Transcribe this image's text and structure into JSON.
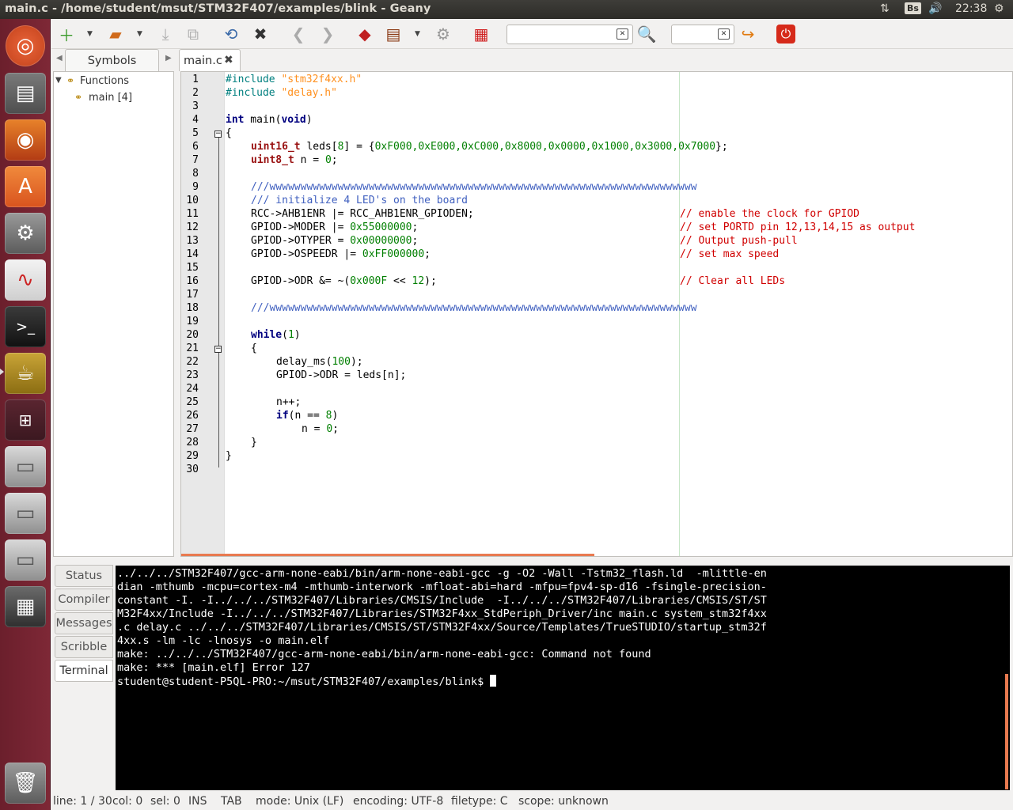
{
  "window_title": "main.c - /home/student/msut/STM32F407/examples/blink - Geany",
  "indicators": {
    "keyboard": "Bs",
    "time": "22:38"
  },
  "sidebar": {
    "tab_label": "Symbols",
    "functions_label": "Functions",
    "main_item": "main [4]"
  },
  "editor": {
    "tab_label": "main.c",
    "lines": [
      "1",
      "2",
      "3",
      "4",
      "5",
      "6",
      "7",
      "8",
      "9",
      "10",
      "11",
      "12",
      "13",
      "14",
      "15",
      "16",
      "17",
      "18",
      "19",
      "20",
      "21",
      "22",
      "23",
      "24",
      "25",
      "26",
      "27",
      "28",
      "29",
      "30"
    ],
    "code": {
      "l1_kw": "#include ",
      "l1_str": "\"stm32f4xx.h\"",
      "l2_kw": "#include ",
      "l2_str": "\"delay.h\"",
      "l4_kw1": "int",
      "l4_mid": " main(",
      "l4_kw2": "void",
      "l4_end": ")",
      "l5": "{",
      "l6_ty": "uint16_t",
      "l6_a": " leds[",
      "l6_n": "8",
      "l6_b": "] = {",
      "l6_vals": "0xF000,0xE000,0xC000,0x8000,0x0000,0x1000,0x3000,0x7000",
      "l6_c": "};",
      "l7_ty": "uint8_t",
      "l7_a": " n = ",
      "l7_n": "0",
      "l7_c": ";",
      "l9": "///wwwwwwwwwwwwwwwwwwwwwwwwwwwwwwwwwwwwwwwwwwwwwwwwwwwwwwwwwwwwwwwwwwwww",
      "l10": "/// initialize 4 LED's on the board",
      "l11_code": "RCC->AHB1ENR |= RCC_AHB1ENR_GPIODEN;",
      "l11_cm": "// enable the clock for GPIOD",
      "l12_a": "GPIOD->MODER |= ",
      "l12_n": "0x55000000",
      "l12_c": ";",
      "l12_cm": "// set PORTD pin 12,13,14,15 as output",
      "l13_a": "GPIOD->OTYPER = ",
      "l13_n": "0x00000000",
      "l13_c": ";",
      "l13_cm": "// Output push-pull",
      "l14_a": "GPIOD->OSPEEDR |= ",
      "l14_n": "0xFF000000",
      "l14_c": ";",
      "l14_cm": "// set max speed",
      "l16_a": "GPIOD->ODR &= ~(",
      "l16_n1": "0x000F",
      "l16_b": " << ",
      "l16_n2": "12",
      "l16_c": ");",
      "l16_cm": "// Clear all LEDs",
      "l18": "///wwwwwwwwwwwwwwwwwwwwwwwwwwwwwwwwwwwwwwwwwwwwwwwwwwwwwwwwwwwwwwwwwwwww",
      "l20_kw": "while",
      "l20_a": "(",
      "l20_n": "1",
      "l20_b": ")",
      "l21": "{",
      "l22_a": "delay_ms(",
      "l22_n": "100",
      "l22_b": ");",
      "l23": "GPIOD->ODR = leds[n];",
      "l25": "n++;",
      "l26_kw": "if",
      "l26_a": "(n == ",
      "l26_n": "8",
      "l26_b": ")",
      "l27_a": "n = ",
      "l27_n": "0",
      "l27_b": ";",
      "l28": "}",
      "l29": "}"
    }
  },
  "message_tabs": [
    "Status",
    "Compiler",
    "Messages",
    "Scribble",
    "Terminal"
  ],
  "terminal": {
    "lines": [
      "../../../STM32F407/gcc-arm-none-eabi/bin/arm-none-eabi-gcc -g -O2 -Wall -Tstm32_flash.ld  -mlittle-en",
      "dian -mthumb -mcpu=cortex-m4 -mthumb-interwork -mfloat-abi=hard -mfpu=fpv4-sp-d16 -fsingle-precision-",
      "constant -I. -I../../../STM32F407/Libraries/CMSIS/Include  -I../../../STM32F407/Libraries/CMSIS/ST/ST",
      "M32F4xx/Include -I../../../STM32F407/Libraries/STM32F4xx_StdPeriph_Driver/inc main.c system_stm32f4xx",
      ".c delay.c ../../../STM32F407/Libraries/CMSIS/ST/STM32F4xx/Source/Templates/TrueSTUDIO/startup_stm32f",
      "4xx.s -lm -lc -lnosys -o main.elf",
      "make: ../../../STM32F407/gcc-arm-none-eabi/bin/arm-none-eabi-gcc: Command not found",
      "make: *** [main.elf] Error 127"
    ],
    "prompt": "student@student-P5QL-PRO:~/msut/STM32F407/examples/blink$ "
  },
  "status": {
    "line": "line: 1 / 30",
    "col": "col: 0",
    "sel": "sel: 0",
    "ins": "INS",
    "tab": "TAB",
    "mode": "mode: Unix (LF)",
    "encoding": "encoding: UTF-8",
    "filetype": "filetype: C",
    "scope": "scope: unknown"
  },
  "colors": {
    "launcher": "#7e2836",
    "keyword": "#00007f",
    "type": "#991111",
    "string": "#ff901e",
    "number": "#007f00",
    "comment": "#d00000",
    "doc_comment": "#3f5fbf"
  },
  "icons": [
    "ubuntu-icon",
    "files-icon",
    "firefox-icon",
    "software-center-icon",
    "settings-icon",
    "document-viewer-icon",
    "terminal-icon",
    "geany-icon",
    "workspaces-icon",
    "drive-icon",
    "trash-icon"
  ]
}
